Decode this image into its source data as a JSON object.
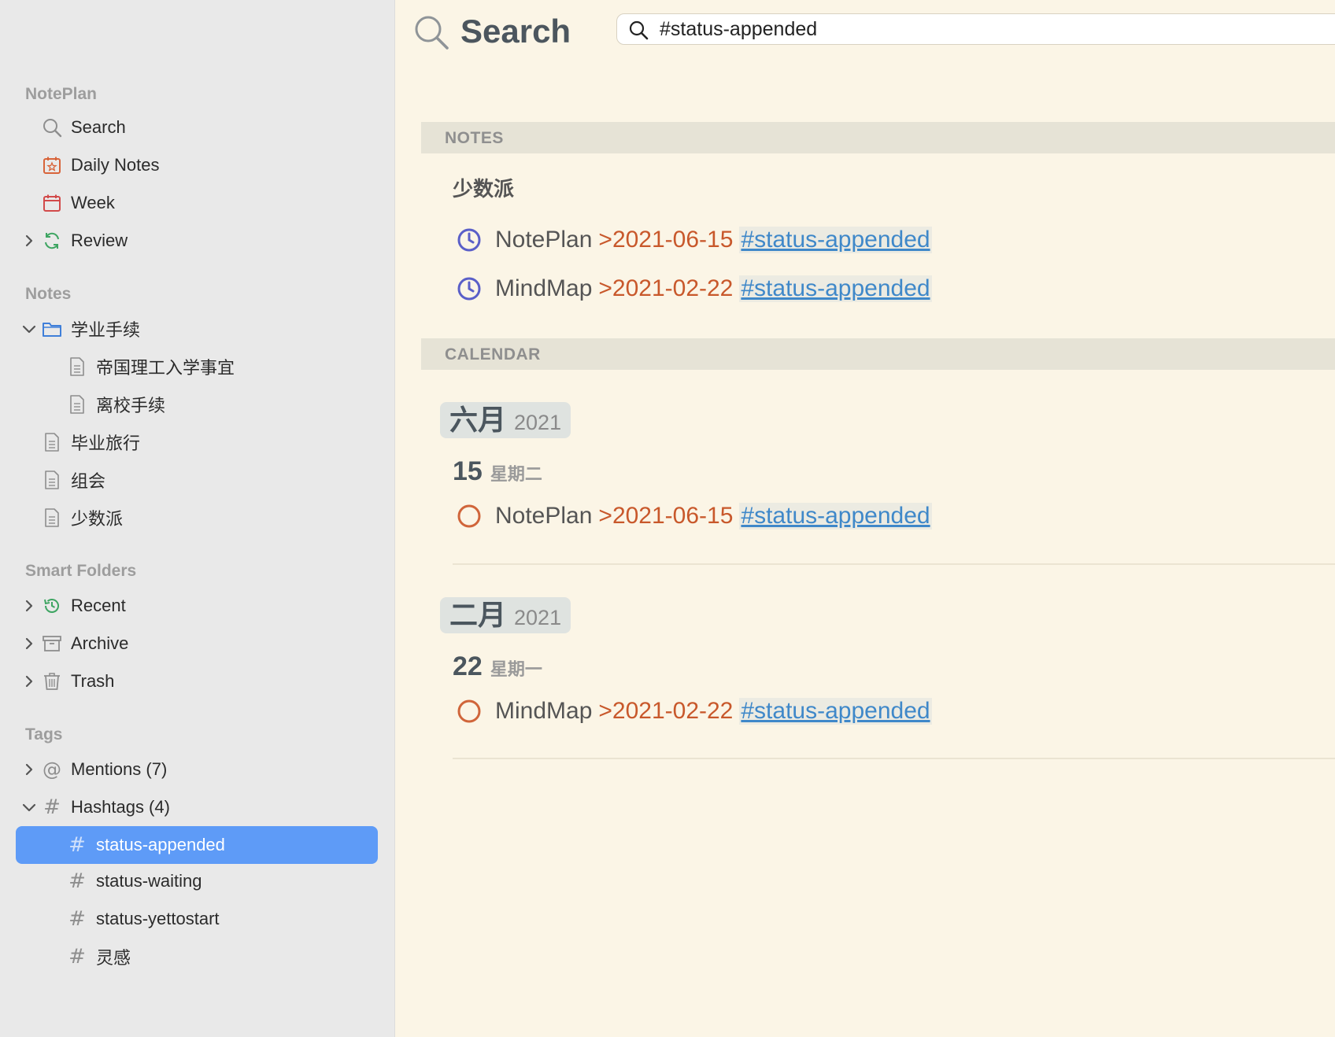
{
  "sidebar": {
    "sections": {
      "noteplan": "NotePlan",
      "notes": "Notes",
      "smart_folders": "Smart Folders",
      "tags": "Tags"
    },
    "items": {
      "search": "Search",
      "daily_notes": "Daily Notes",
      "week": "Week",
      "review": "Review",
      "folder_academic": "学业手续",
      "note_imperial": "帝国理工入学事宜",
      "note_leaving": "离校手续",
      "note_graduation_trip": "毕业旅行",
      "note_group_meeting": "组会",
      "note_minority": "少数派",
      "recent": "Recent",
      "archive": "Archive",
      "trash": "Trash",
      "mentions": "Mentions (7)",
      "hashtags": "Hashtags (4)",
      "tag_appended": "status-appended",
      "tag_waiting": "status-waiting",
      "tag_yettostart": "status-yettostart",
      "tag_inspiration": "灵感"
    }
  },
  "main": {
    "title": "Search",
    "query": "#status-appended",
    "notes_header": "NOTES",
    "calendar_header": "CALENDAR",
    "note_group_title": "少数派",
    "note_tasks": [
      {
        "name": "NotePlan",
        "date": ">2021-06-15",
        "tag": "#status-appended"
      },
      {
        "name": "MindMap",
        "date": ">2021-02-22",
        "tag": "#status-appended"
      }
    ],
    "calendar": [
      {
        "month": "六月",
        "year": "2021",
        "day": "15",
        "weekday": "星期二",
        "task": {
          "name": "NotePlan",
          "date": ">2021-06-15",
          "tag": "#status-appended"
        }
      },
      {
        "month": "二月",
        "year": "2021",
        "day": "22",
        "weekday": "星期一",
        "task": {
          "name": "MindMap",
          "date": ">2021-02-22",
          "tag": "#status-appended"
        }
      }
    ]
  },
  "colors": {
    "selection": "#5e9bf7",
    "date": "#c8582b",
    "tag": "#3f88c9",
    "scheduled_icon": "#5a5fc8",
    "open_task_icon": "#d0653a"
  }
}
